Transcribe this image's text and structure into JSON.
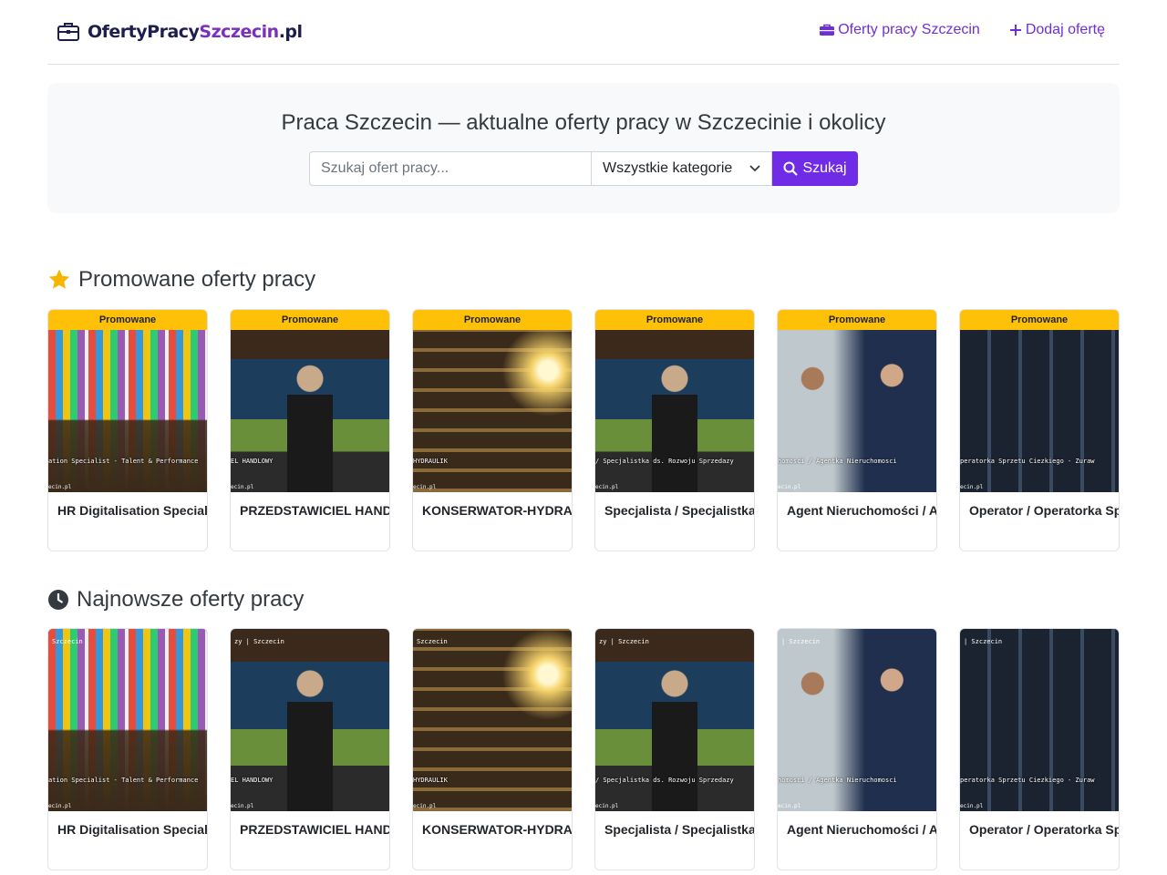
{
  "header": {
    "logo_part1": "OfertyPracy",
    "logo_part2": "Szczecin",
    "logo_part3": ".pl",
    "nav": [
      {
        "label": "Oferty pracy Szczecin",
        "icon": "briefcase-icon"
      },
      {
        "label": "Dodaj ofertę",
        "icon": "plus-icon"
      }
    ]
  },
  "hero": {
    "title": "Praca Szczecin — aktualne oferty pracy w Szczecinie i okolicy",
    "search_placeholder": "Szukaj ofert pracy...",
    "category_selected": "Wszystkie kategorie",
    "search_button": "Szukaj"
  },
  "promoted": {
    "title": "Promowane oferty pracy",
    "icon": "star-icon",
    "badge": "Promowane",
    "items": [
      {
        "title": "HR Digitalisation Specialist - Talent & Performance",
        "caption": "ation Specialist - Talent & Performance",
        "watermark": "ecin.pl",
        "scene": "office"
      },
      {
        "title": "PRZEDSTAWICIEL HANDLOWY",
        "caption": "EL HANDLOWY",
        "watermark": "ecin.pl",
        "scene": "shop"
      },
      {
        "title": "KONSERWATOR-HYDRAULIK",
        "caption": "HYDRAULIK",
        "watermark": "ecin.pl",
        "scene": "build"
      },
      {
        "title": "Specjalista / Specjalistka ds. Rozwoju Sprzedaży",
        "caption": "/ Specjalistka ds. Rozwoju Sprzedazy",
        "watermark": "ecin.pl",
        "scene": "shop"
      },
      {
        "title": "Agent Nieruchomości / Agentka Nieruchomości",
        "caption": "homosci / Agentka Nieruchomosci",
        "watermark": "ecin.pl",
        "scene": "realty"
      },
      {
        "title": "Operator / Operatorka Sprzętu Ciężkiego - Żuraw",
        "caption": "peratorka Sprzetu Ciezkiego - Zuraw",
        "watermark": "ecin.pl",
        "scene": "operator"
      }
    ]
  },
  "latest": {
    "title": "Najnowsze oferty pracy",
    "icon": "clock-icon",
    "items": [
      {
        "title": "HR Digitalisation Specialist - Talent & Performance",
        "caption": "ation Specialist - Talent & Performance",
        "watermark": "ecin.pl",
        "topmark": "Szczecin",
        "scene": "office"
      },
      {
        "title": "PRZEDSTAWICIEL HANDLOWY",
        "caption": "EL HANDLOWY",
        "watermark": "ecin.pl",
        "topmark": "zy  |  Szczecin",
        "scene": "shop"
      },
      {
        "title": "KONSERWATOR-HYDRAULIK",
        "caption": "HYDRAULIK",
        "watermark": "ecin.pl",
        "topmark": "Szczecin",
        "scene": "build"
      },
      {
        "title": "Specjalista / Specjalistka ds. Rozwoju Sprzedaży",
        "caption": "/ Specjalistka ds. Rozwoju Sprzedazy",
        "watermark": "ecin.pl",
        "topmark": "zy  |  Szczecin",
        "scene": "shop"
      },
      {
        "title": "Agent Nieruchomości / Agentka Nieruchomości",
        "caption": "homosci / Agentka Nieruchomosci",
        "watermark": "ecin.pl",
        "topmark": "|  Szczecin",
        "scene": "realty"
      },
      {
        "title": "Operator / Operatorka Sprzętu Ciężkiego - Żuraw",
        "caption": "peratorka Sprzetu Ciezkiego - Zuraw",
        "watermark": "ecin.pl",
        "topmark": "|  Szczecin",
        "scene": "operator"
      }
    ]
  },
  "colors": {
    "accent": "#6f2be6",
    "badge": "#ffc107",
    "hero_bg": "#f8f9fa"
  }
}
